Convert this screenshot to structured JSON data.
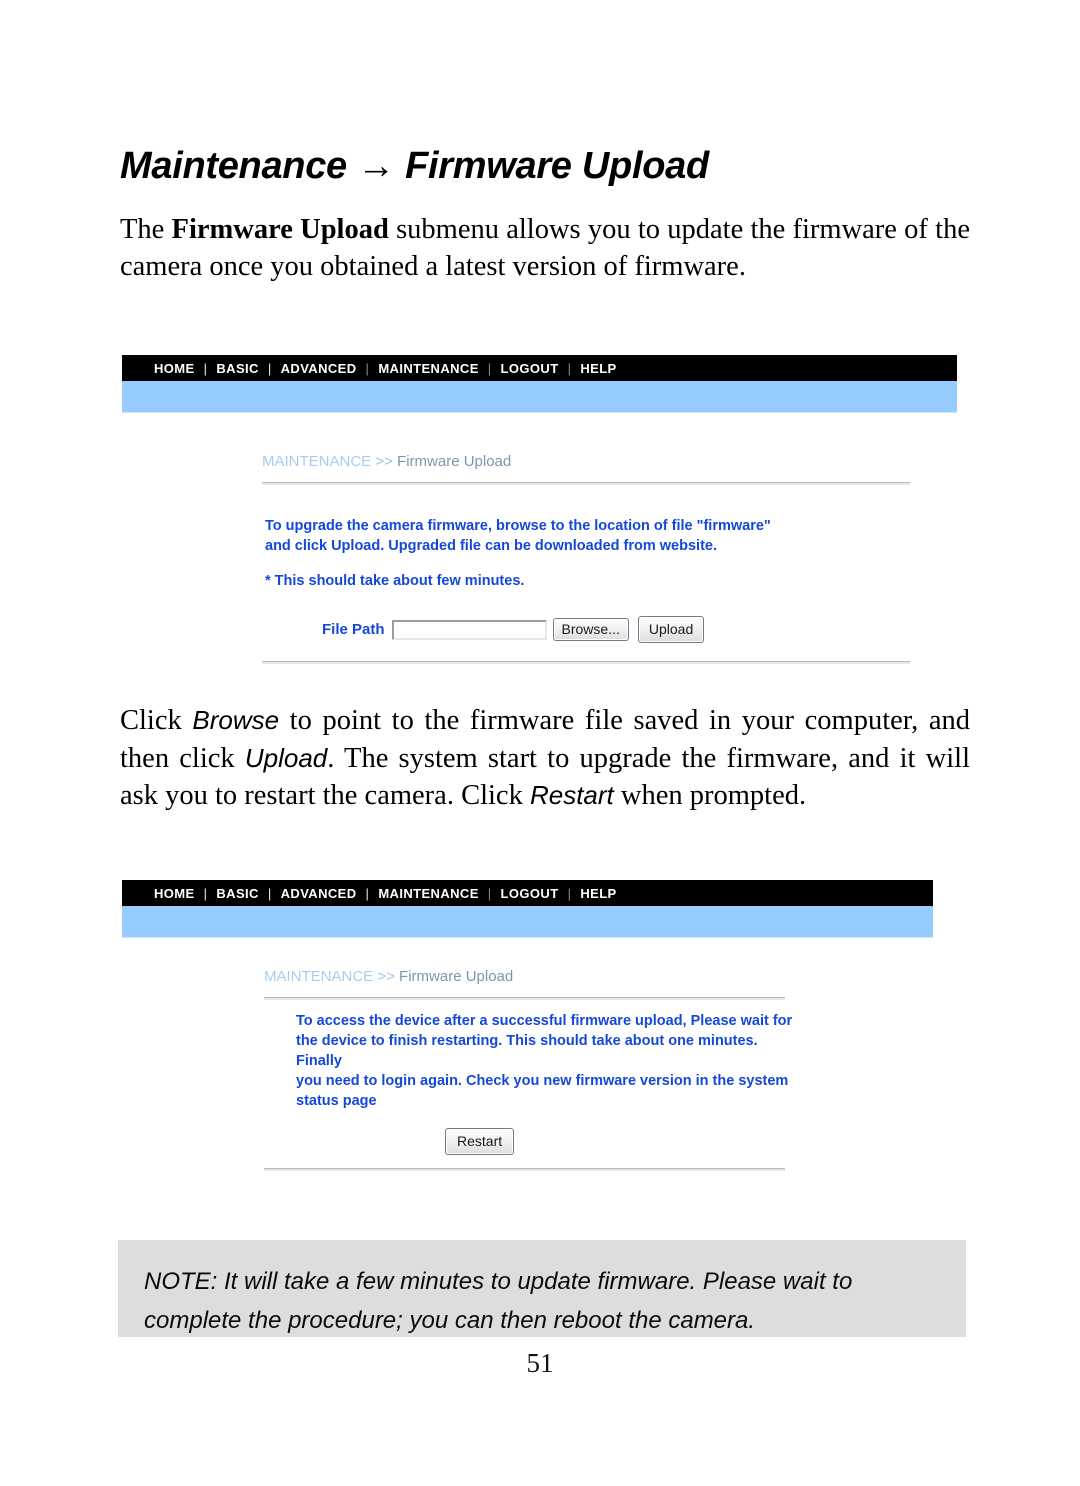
{
  "document": {
    "heading": "Maintenance → Firmware Upload",
    "intro_paragraph": {
      "before_bold": "The ",
      "bold": "Firmware Upload",
      "after_bold": " submenu allows you to update the firmware of the camera once you obtained a latest version of firmware."
    },
    "middle_paragraph": {
      "p1": "Click ",
      "em1": "Browse",
      "p2": " to point to the firmware file saved in your computer, and then click ",
      "em2": "Upload",
      "p3": ".  The system start to upgrade the firmware, and it will ask you to restart the camera.  Click ",
      "em3": "Restart",
      "p4": " when prompted."
    },
    "note": {
      "label": "NOTE:",
      "text": " It will take a few minutes to update firmware.  Please wait to complete the procedure; you can then reboot the camera."
    },
    "page_number": "51"
  },
  "nav": {
    "items": [
      "HOME",
      "BASIC",
      "ADVANCED",
      "MAINTENANCE",
      "LOGOUT",
      "HELP"
    ],
    "separator": "|"
  },
  "screenshot_upload": {
    "breadcrumb": {
      "section": "MAINTENANCE",
      "separator": " >> ",
      "page": "Firmware Upload"
    },
    "instructions_line1": "To upgrade the camera firmware, browse to the location of file \"firmware\"",
    "instructions_line2": "and click Upload. Upgraded file can be downloaded from website.",
    "note_line": "* This should take about few minutes.",
    "form": {
      "file_path_label": "File Path",
      "file_path_value": "",
      "file_path_placeholder": "",
      "browse_button": "Browse...",
      "upload_button": "Upload"
    }
  },
  "screenshot_restart": {
    "breadcrumb": {
      "section": "MAINTENANCE",
      "separator": " >> ",
      "page": "Firmware Upload"
    },
    "message_line1": "To access the device after a successful firmware upload, Please wait for",
    "message_line2": "the device to finish restarting. This should take about one minutes. Finally",
    "message_line3": "you need to login again. Check you new firmware version in the system",
    "message_line4": "status page",
    "restart_button": "Restart"
  },
  "colors": {
    "navbar_bg": "#000000",
    "subbar_bg": "#96ccff",
    "link_blue": "#1548d8",
    "breadcrumb_light": "#a8cdf0",
    "breadcrumb_dark": "#7e95ae",
    "note_bg": "#dddddd"
  }
}
